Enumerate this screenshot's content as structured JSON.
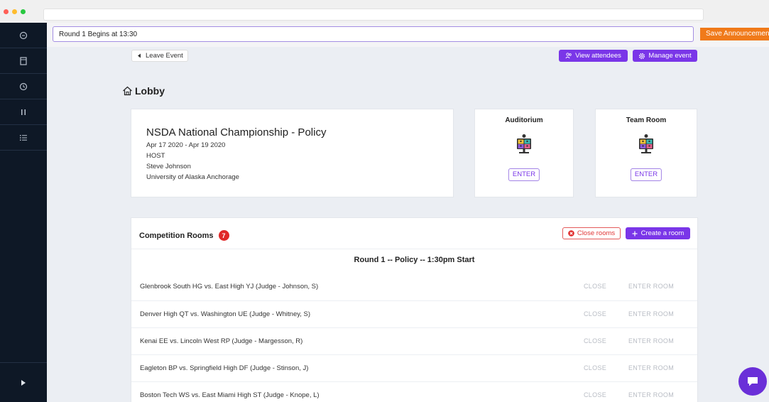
{
  "announcement": {
    "value": "Round 1 Begins at 13:30",
    "save_label": "Save Announcement"
  },
  "toolbar": {
    "leave_label": "Leave Event",
    "view_attendees_label": "View attendees",
    "manage_event_label": "Manage event"
  },
  "lobby": {
    "title": "Lobby"
  },
  "event": {
    "title": "NSDA National Championship - Policy",
    "dates": "Apr 17 2020  -  Apr 19 2020",
    "host_label": "HOST",
    "host_name": "Steve Johnson",
    "host_org": "University of Alaska Anchorage"
  },
  "rooms": [
    {
      "title": "Auditorium",
      "enter_label": "ENTER"
    },
    {
      "title": "Team Room",
      "enter_label": "ENTER"
    }
  ],
  "competition": {
    "title": "Competition Rooms",
    "count": "7",
    "close_rooms_label": "Close rooms",
    "create_room_label": "Create a room",
    "round_heading": "Round 1 -- Policy -- 1:30pm Start",
    "close_label": "CLOSE",
    "enter_room_label": "ENTER ROOM",
    "matches": [
      "Glenbrook South HG vs. East High YJ (Judge - Johnson, S)",
      "Denver High QT vs. Washington UE (Judge - Whitney, S)",
      "Kenai EE vs. Lincoln West RP (Judge - Margesson, R)",
      "Eagleton BP vs. Springfield High DF (Judge - Stinson, J)",
      "Boston Tech WS vs. East Miami High ST (Judge - Knope, L)"
    ]
  },
  "colors": {
    "accent": "#7a36e8",
    "save": "#f07a1a",
    "danger": "#e02828",
    "sidebar": "#0e1826"
  },
  "icons": {
    "sidebar": [
      "chat-icon",
      "bookmark-icon",
      "clock-icon",
      "pause-icon",
      "list-icon"
    ],
    "bottom": "play-icon"
  }
}
